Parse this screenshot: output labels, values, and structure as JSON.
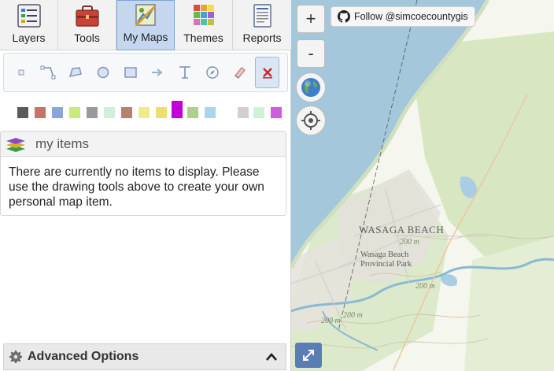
{
  "tabs": [
    {
      "label": "Layers"
    },
    {
      "label": "Tools"
    },
    {
      "label": "My Maps",
      "active": true
    },
    {
      "label": "Themes"
    },
    {
      "label": "Reports"
    }
  ],
  "drawing_tools": [
    {
      "icon": "point-icon"
    },
    {
      "icon": "line-icon"
    },
    {
      "icon": "polygon-icon"
    },
    {
      "icon": "circle-icon"
    },
    {
      "icon": "rectangle-icon"
    },
    {
      "icon": "arrow-icon"
    },
    {
      "icon": "text-icon"
    },
    {
      "icon": "compass-icon"
    },
    {
      "icon": "eraser-icon"
    },
    {
      "icon": "delete-icon",
      "selected": true
    }
  ],
  "palette": [
    {
      "color": "#5a5a5a"
    },
    {
      "color": "#c8706a"
    },
    {
      "color": "#8aa6d6"
    },
    {
      "color": "#c8ec7c"
    },
    {
      "color": "#9a9a9a"
    },
    {
      "color": "#cfeedb"
    },
    {
      "color": "#b97f72"
    },
    {
      "color": "#efec88"
    },
    {
      "color": "#ecdf6c"
    },
    {
      "color": "#c100d8",
      "selected": true
    },
    {
      "color": "#afcf8a"
    },
    {
      "color": "#a9d6ec"
    },
    {
      "color": "#d0d0d0"
    },
    {
      "color": "#cff2d6"
    },
    {
      "color": "#cf5cdb"
    }
  ],
  "my_items": {
    "title": "my items",
    "empty_message": "There are currently no items to display. Please use the drawing tools above to create your own personal map item."
  },
  "advanced_options": {
    "label": "Advanced Options"
  },
  "map": {
    "zoom_in": "+",
    "zoom_out": "-",
    "follow_label": "Follow @simcoecountygis",
    "place_label": "WASAGA BEACH",
    "park_label_1": "Wasaga Beach",
    "park_label_2": "Provincial Park",
    "elevation_labels": [
      "200 m",
      "200 m",
      "200 m",
      "200 m"
    ],
    "colors": {
      "water": "#a5c7db",
      "land": "#f5f6ee",
      "park": "#d8e7c2",
      "urban": "#e4e0dc"
    }
  }
}
